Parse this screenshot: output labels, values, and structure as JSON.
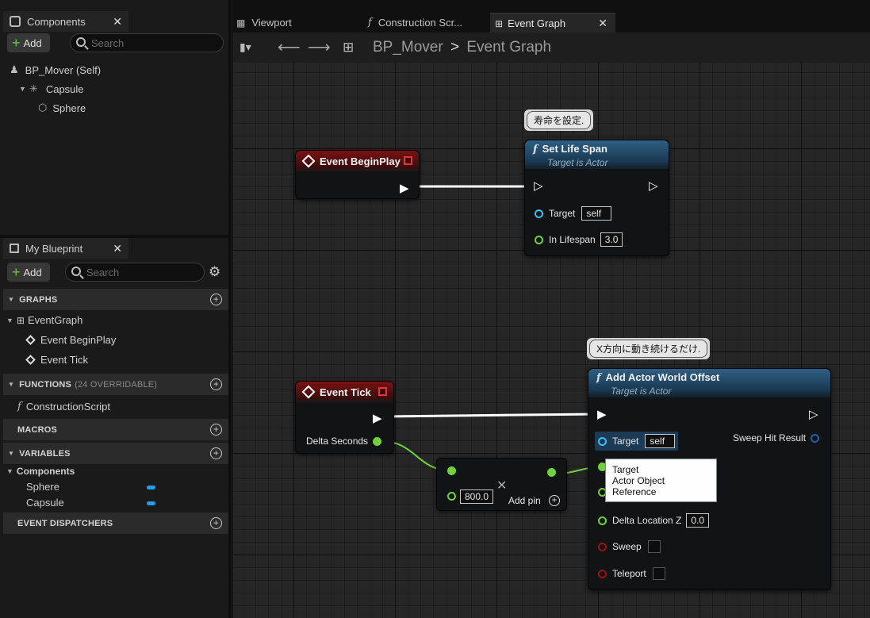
{
  "components_panel": {
    "tab_label": "Components",
    "add_label": "Add",
    "search_placeholder": "Search",
    "tree": [
      {
        "label": "BP_Mover (Self)"
      },
      {
        "label": "Capsule"
      },
      {
        "label": "Sphere"
      }
    ]
  },
  "my_blueprint": {
    "tab_label": "My Blueprint",
    "add_label": "Add",
    "search_placeholder": "Search",
    "graphs_label": "GRAPHS",
    "graph_items": [
      "EventGraph",
      "Event BeginPlay",
      "Event Tick"
    ],
    "functions_label": "FUNCTIONS",
    "functions_sub": "(24 OVERRIDABLE)",
    "function_items": [
      "ConstructionScript"
    ],
    "macros_label": "MACROS",
    "variables_label": "VARIABLES",
    "variables_group": "Components",
    "variable_items": [
      {
        "label": "Sphere",
        "color": "#1fa1e8"
      },
      {
        "label": "Capsule",
        "color": "#1fa1e8"
      }
    ],
    "dispatchers_label": "EVENT DISPATCHERS"
  },
  "editor_tabs": [
    {
      "label": "Viewport"
    },
    {
      "label": "Construction Scr..."
    },
    {
      "label": "Event Graph"
    }
  ],
  "breadcrumb": {
    "root": "BP_Mover",
    "sep": ">",
    "leaf": "Event Graph"
  },
  "graph": {
    "comment1": "寿命を設定.",
    "comment2": "X方向に動き続けるだけ.",
    "begin_play": {
      "title": "Event BeginPlay"
    },
    "set_life_span": {
      "title": "Set Life Span",
      "subtitle": "Target is Actor",
      "target_label": "Target",
      "target_value": "self",
      "lifespan_label": "In Lifespan",
      "lifespan_value": "3.0"
    },
    "event_tick": {
      "title": "Event Tick",
      "delta_label": "Delta Seconds"
    },
    "multiply": {
      "value": "800.0",
      "add_pin_label": "Add pin"
    },
    "add_offset": {
      "title": "Add Actor World Offset",
      "subtitle": "Target is Actor",
      "target_label": "Target",
      "target_value": "self",
      "sweep_hit_label": "Sweep Hit Result",
      "delta_z_label": "Delta Location Z",
      "delta_z_value": "0.0",
      "sweep_label": "Sweep",
      "teleport_label": "Teleport"
    },
    "tooltip": {
      "line1": "Target",
      "line2": "Actor Object Reference"
    }
  },
  "colors": {
    "exec_wire": "#ffffff",
    "float_wire": "#6fd23c",
    "object_pin": "#3dbdf2",
    "bool_pin": "#a01010",
    "event_header": "#7a1212",
    "function_header": "#2e5f82"
  }
}
